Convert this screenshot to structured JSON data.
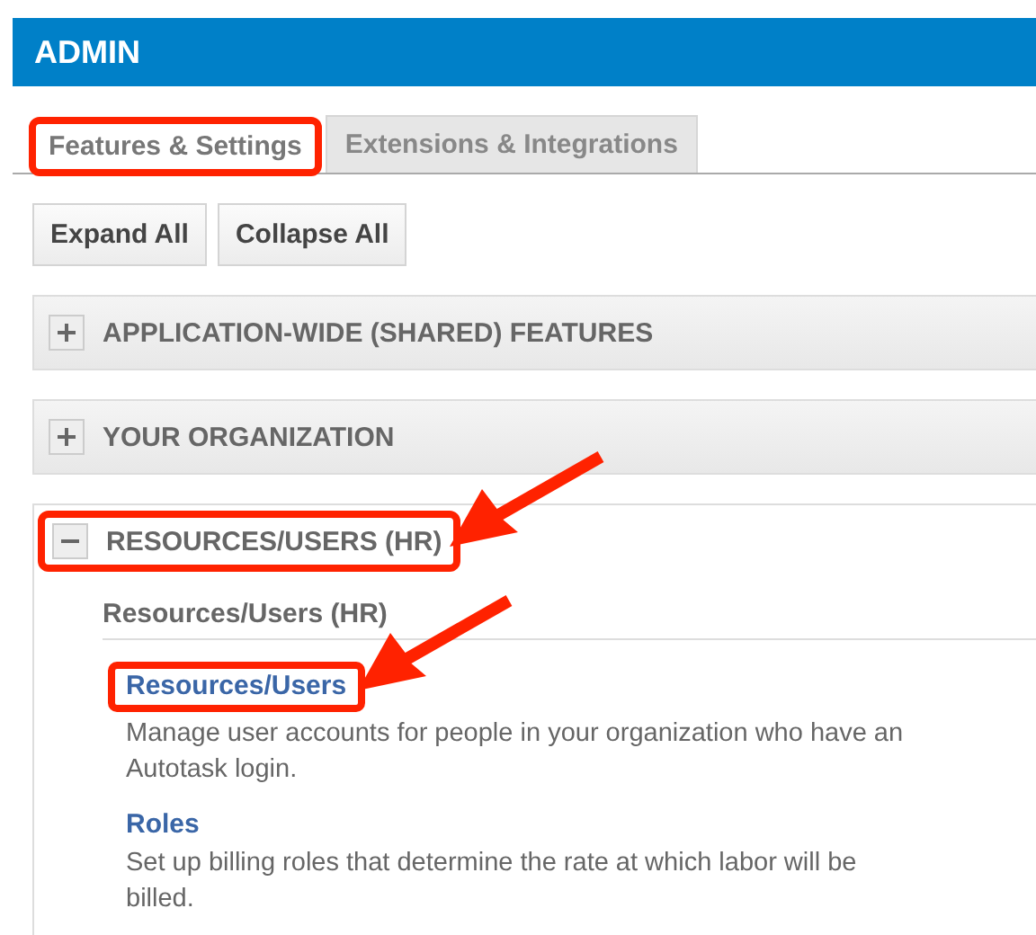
{
  "header": {
    "title": "ADMIN"
  },
  "tabs": [
    {
      "label": "Features & Settings",
      "selected": true,
      "annotated": true
    },
    {
      "label": "Extensions & Integrations",
      "selected": false,
      "annotated": false
    }
  ],
  "buttons": [
    "Expand All",
    "Collapse All"
  ],
  "sections": [
    {
      "title": "APPLICATION-WIDE (SHARED) FEATURES",
      "expanded": false,
      "annotated": false
    },
    {
      "title": "YOUR ORGANIZATION",
      "expanded": false,
      "annotated": false
    },
    {
      "title": "RESOURCES/USERS (HR)",
      "expanded": true,
      "annotated": true,
      "group_title": "Resources/Users (HR)",
      "links": [
        {
          "title": "Resources/Users",
          "description": "Manage user accounts for people in your organization who have an Autotask login.",
          "annotated": true
        },
        {
          "title": "Roles",
          "description": "Set up billing roles that determine the rate at which labor will be billed.",
          "annotated": false
        }
      ]
    }
  ]
}
